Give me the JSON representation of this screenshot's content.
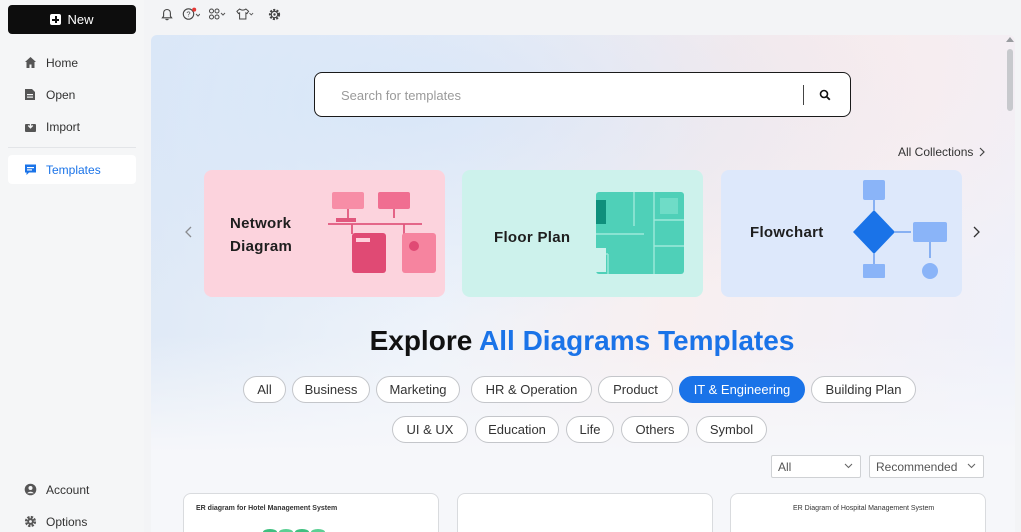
{
  "sidebar": {
    "new_label": "New",
    "items": [
      {
        "label": "Home"
      },
      {
        "label": "Open"
      },
      {
        "label": "Import"
      },
      {
        "label": "Templates"
      }
    ],
    "bottom_items": [
      {
        "label": "Account"
      },
      {
        "label": "Options"
      }
    ]
  },
  "topbar": {
    "icons": [
      "bell-icon",
      "help-icon",
      "apps-icon",
      "shirt-icon",
      "settings-icon"
    ]
  },
  "search": {
    "placeholder": "Search for templates"
  },
  "collections": {
    "all_label": "All Collections"
  },
  "cards": [
    {
      "title": "Network Diagram",
      "title_lines": [
        "Network",
        "Diagram"
      ],
      "color": "#fcd3dd"
    },
    {
      "title": "Floor Plan",
      "title_lines": [
        "Floor  Plan"
      ],
      "color": "#cdf2ec"
    },
    {
      "title": "Flowchart",
      "title_lines": [
        "Flowchart"
      ],
      "color": "#dde8fb"
    }
  ],
  "explore": {
    "prefix": "Explore",
    "accent": "All Diagrams Templates"
  },
  "categories_row1": [
    "All",
    "Business",
    "Marketing",
    "HR & Operation",
    "Product",
    "IT & Engineering",
    "Building Plan"
  ],
  "categories_row2": [
    "UI & UX",
    "Education",
    "Life",
    "Others",
    "Symbol"
  ],
  "active_category": "IT & Engineering",
  "filters": {
    "type_value": "All",
    "sort_value": "Recommended"
  },
  "templates": [
    {
      "caption": "ER diagram for Hotel Management System"
    },
    {
      "caption": ""
    },
    {
      "caption": "ER Diagram of Hospital Management System"
    }
  ],
  "colors": {
    "accent": "#1a73e8",
    "new_button": "#0d0d0d"
  }
}
